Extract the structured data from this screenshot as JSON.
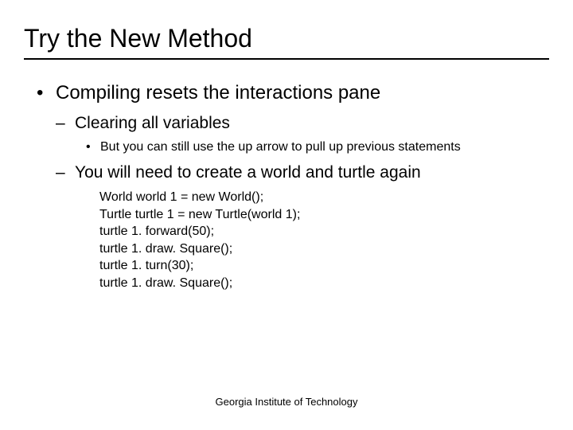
{
  "title": "Try the New Method",
  "bullet1": "Compiling resets the interactions pane",
  "sub1": "Clearing all variables",
  "sub1_detail": "But you can still use the up arrow to pull up previous statements",
  "sub2": "You will need to create a world and turtle again",
  "code": {
    "line1": "World world 1 = new World();",
    "line2": "Turtle turtle 1 = new Turtle(world 1);",
    "line3": "turtle 1. forward(50);",
    "line4": "turtle 1. draw. Square();",
    "line5": "turtle 1. turn(30);",
    "line6": "turtle 1. draw. Square();"
  },
  "footer": "Georgia Institute of Technology"
}
